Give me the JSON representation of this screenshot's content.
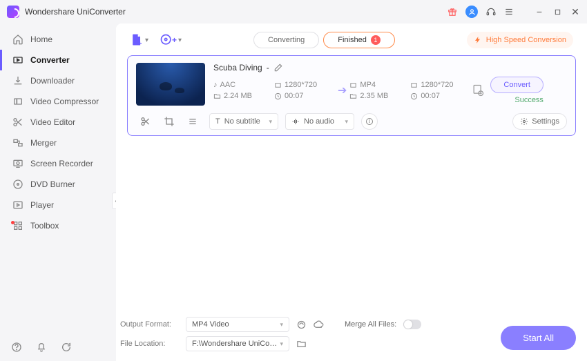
{
  "app": {
    "title": "Wondershare UniConverter"
  },
  "titlebar": {
    "gift": "gift-icon",
    "user": "user-icon",
    "support": "headset-icon",
    "menu": "menu-icon",
    "min": "−",
    "max": "□",
    "close": "✕"
  },
  "sidebar": {
    "items": [
      {
        "label": "Home",
        "icon": "home-icon",
        "active": false
      },
      {
        "label": "Converter",
        "icon": "converter-icon",
        "active": true
      },
      {
        "label": "Downloader",
        "icon": "download-icon",
        "active": false
      },
      {
        "label": "Video Compressor",
        "icon": "compress-icon",
        "active": false
      },
      {
        "label": "Video Editor",
        "icon": "scissors-icon",
        "active": false
      },
      {
        "label": "Merger",
        "icon": "merge-icon",
        "active": false
      },
      {
        "label": "Screen Recorder",
        "icon": "record-icon",
        "active": false
      },
      {
        "label": "DVD Burner",
        "icon": "dvd-icon",
        "active": false
      },
      {
        "label": "Player",
        "icon": "player-icon",
        "active": false
      },
      {
        "label": "Toolbox",
        "icon": "toolbox-icon",
        "active": false,
        "badge": true
      }
    ]
  },
  "toolbar": {
    "tabs": {
      "converting": "Converting",
      "finished": "Finished",
      "finished_count": "1"
    },
    "high_speed": "High Speed Conversion"
  },
  "card": {
    "title": "Scuba Diving",
    "title_suffix": " - ",
    "source": {
      "codec": "AAC",
      "resolution": "1280*720",
      "size": "2.24 MB",
      "duration": "00:07"
    },
    "target": {
      "codec": "MP4",
      "resolution": "1280*720",
      "size": "2.35 MB",
      "duration": "00:07"
    },
    "convert_btn": "Convert",
    "status": "Success",
    "subtitle": "No subtitle",
    "audio": "No audio",
    "settings": "Settings"
  },
  "bottom": {
    "output_format_label": "Output Format:",
    "output_format_value": "MP4 Video",
    "file_location_label": "File Location:",
    "file_location_value": "F:\\Wondershare UniConverter",
    "merge_label": "Merge All Files:",
    "start_all": "Start All"
  }
}
